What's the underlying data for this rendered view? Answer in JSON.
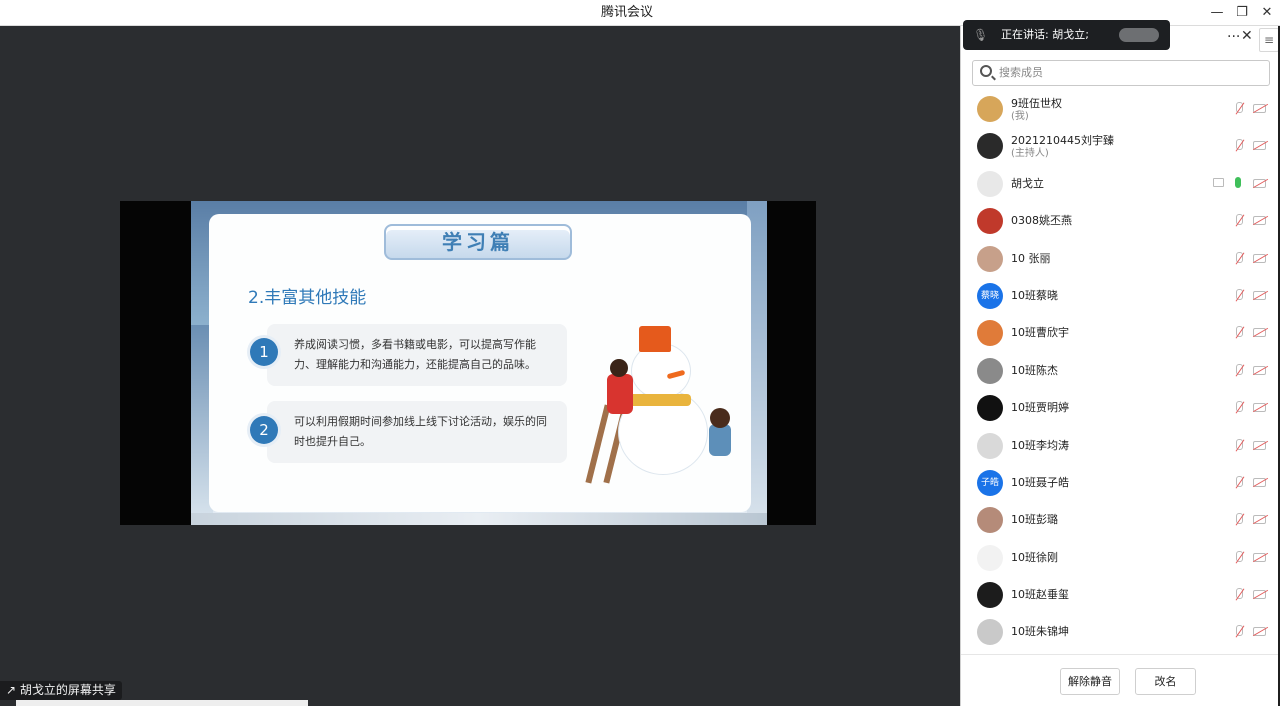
{
  "window": {
    "title": "腾讯会议",
    "controls": [
      "—",
      "❐",
      "✕"
    ]
  },
  "speaking": {
    "label": "正在讲话: 胡戈立;"
  },
  "panel": {
    "more_label": "···",
    "close_label": "✕",
    "menu_label": "≡",
    "search_placeholder": "搜索成员",
    "unmute_all_label": "解除静音",
    "rename_label": "改名"
  },
  "members": [
    {
      "name": "9班伍世权",
      "sub": "(我)",
      "avatar_color": "#d7a65a",
      "avatar_text": "",
      "mic": "off"
    },
    {
      "name": "2021210445刘宇臻",
      "sub": "(主持人)",
      "avatar_color": "#2a2a2a",
      "avatar_text": "",
      "mic": "off"
    },
    {
      "name": "胡戈立",
      "sub": "",
      "avatar_color": "#e8e8e8",
      "avatar_text": "",
      "mic": "on"
    },
    {
      "name": "0308姚丕燕",
      "sub": "",
      "avatar_color": "#c0392b",
      "avatar_text": "",
      "mic": "off"
    },
    {
      "name": "10 张丽",
      "sub": "",
      "avatar_color": "#c7a08a",
      "avatar_text": "",
      "mic": "off"
    },
    {
      "name": "10班蔡晓",
      "sub": "",
      "avatar_color": "#1a73e8",
      "avatar_text": "蔡晓",
      "mic": "off"
    },
    {
      "name": "10班曹欣宇",
      "sub": "",
      "avatar_color": "#e07b39",
      "avatar_text": "",
      "mic": "off"
    },
    {
      "name": "10班陈杰",
      "sub": "",
      "avatar_color": "#8a8a8a",
      "avatar_text": "",
      "mic": "off"
    },
    {
      "name": "10班贾明婷",
      "sub": "",
      "avatar_color": "#111111",
      "avatar_text": "",
      "mic": "off"
    },
    {
      "name": "10班李均涛",
      "sub": "",
      "avatar_color": "#d9d9d9",
      "avatar_text": "",
      "mic": "off"
    },
    {
      "name": "10班聂子皓",
      "sub": "",
      "avatar_color": "#1a73e8",
      "avatar_text": "子皓",
      "mic": "off"
    },
    {
      "name": "10班彭璐",
      "sub": "",
      "avatar_color": "#b58b79",
      "avatar_text": "",
      "mic": "off"
    },
    {
      "name": "10班徐刚",
      "sub": "",
      "avatar_color": "#f2f2f2",
      "avatar_text": "",
      "mic": "off"
    },
    {
      "name": "10班赵垂玺",
      "sub": "",
      "avatar_color": "#1c1c1c",
      "avatar_text": "",
      "mic": "off"
    },
    {
      "name": "10班朱锦坤",
      "sub": "",
      "avatar_color": "#c9c9c9",
      "avatar_text": "",
      "mic": "off"
    }
  ],
  "slide": {
    "banner": "学习篇",
    "subhead": "2.丰富其他技能",
    "items": [
      {
        "num": "1",
        "text": "养成阅读习惯，多看书籍或电影，可以提高写作能力、理解能力和沟通能力，还能提高自己的品味。"
      },
      {
        "num": "2",
        "text": "可以利用假期时间参加线上线下讨论活动，娱乐的同时也提升自己。"
      }
    ]
  },
  "share_caption": "胡戈立的屏幕共享",
  "colors": {
    "accent": "#2f79b8",
    "speaking_bg": "#1d1f22",
    "stage_bg": "#2b2d30"
  }
}
